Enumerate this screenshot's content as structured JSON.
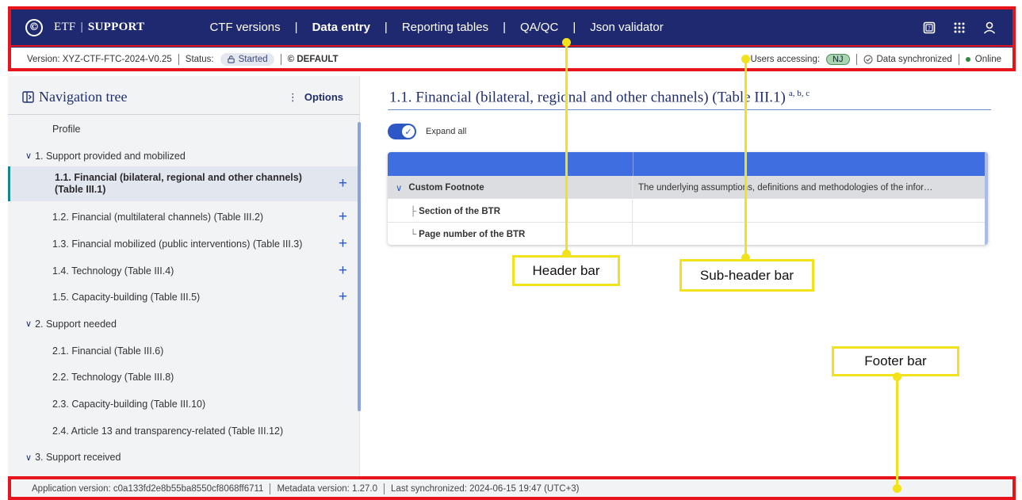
{
  "header": {
    "brand_prefix": "ETF",
    "brand_name": "SUPPORT",
    "logo_glyph": "©",
    "menu": [
      {
        "label": "CTF versions",
        "active": false
      },
      {
        "label": "Data entry",
        "active": true
      },
      {
        "label": "Reporting tables",
        "active": false
      },
      {
        "label": "QA/QC",
        "active": false
      },
      {
        "label": "Json validator",
        "active": false
      }
    ],
    "icons": [
      "help-icon",
      "apps-grid-icon",
      "user-icon"
    ],
    "bg_color": "#1f2970"
  },
  "subheader": {
    "version": "Version: XYZ-CTF-FTC-2024-V0.25",
    "status_label": "Status:",
    "status_value": "Started",
    "default_label": "DEFAULT",
    "users_accessing_label": "Users accessing:",
    "user_badge": "NJ",
    "sync_status": "Data synchronized",
    "online_status": "Online"
  },
  "sidebar": {
    "title": "Navigation tree",
    "options_label": "Options",
    "items": [
      {
        "label": "Profile",
        "level": 1,
        "expandable": false,
        "addable": false,
        "selected": false
      },
      {
        "label": "1. Support provided and mobilized",
        "level": 0,
        "expandable": true,
        "addable": false,
        "selected": false
      },
      {
        "label": "1.1. Financial (bilateral, regional and other channels) (Table III.1)",
        "level": 1,
        "expandable": false,
        "addable": true,
        "selected": true
      },
      {
        "label": "1.2. Financial (multilateral channels) (Table III.2)",
        "level": 1,
        "expandable": false,
        "addable": true,
        "selected": false
      },
      {
        "label": "1.3. Financial mobilized (public interventions) (Table III.3)",
        "level": 1,
        "expandable": false,
        "addable": true,
        "selected": false
      },
      {
        "label": "1.4. Technology (Table III.4)",
        "level": 1,
        "expandable": false,
        "addable": true,
        "selected": false
      },
      {
        "label": "1.5. Capacity-building (Table III.5)",
        "level": 1,
        "expandable": false,
        "addable": true,
        "selected": false
      },
      {
        "label": "2. Support needed",
        "level": 0,
        "expandable": true,
        "addable": false,
        "selected": false
      },
      {
        "label": "2.1. Financial (Table III.6)",
        "level": 1,
        "expandable": false,
        "addable": false,
        "selected": false
      },
      {
        "label": "2.2. Technology (Table III.8)",
        "level": 1,
        "expandable": false,
        "addable": false,
        "selected": false
      },
      {
        "label": "2.3. Capacity-building (Table III.10)",
        "level": 1,
        "expandable": false,
        "addable": false,
        "selected": false
      },
      {
        "label": "2.4. Article 13 and transparency-related (Table III.12)",
        "level": 1,
        "expandable": false,
        "addable": false,
        "selected": false
      },
      {
        "label": "3. Support received",
        "level": 0,
        "expandable": true,
        "addable": false,
        "selected": false
      }
    ]
  },
  "main": {
    "title": "1.1. Financial (bilateral, regional and other channels) (Table III.1)",
    "title_superscript": "a, b, c",
    "expand_all_label": "Expand all",
    "expand_all_on": true,
    "table": {
      "rows": [
        {
          "label": "Custom Footnote",
          "value": "The underlying assumptions, definitions and methodologies of the infor…",
          "prefix": "∨"
        },
        {
          "label": "Section of the BTR",
          "value": "",
          "prefix": "├"
        },
        {
          "label": "Page number of the BTR",
          "value": "",
          "prefix": "└"
        }
      ]
    }
  },
  "footer": {
    "app_version": "Application version: c0a133fd2e8b55ba8550cf8068ff6711",
    "metadata_version": "Metadata version: 1.27.0",
    "last_sync": "Last synchronized: 2024-06-15 19:47 (UTC+3)"
  },
  "annotations": {
    "header_label": "Header bar",
    "subheader_label": "Sub-header bar",
    "footer_label": "Footer bar",
    "frame_color": "#e8141c",
    "callout_color": "#f2e21a"
  }
}
